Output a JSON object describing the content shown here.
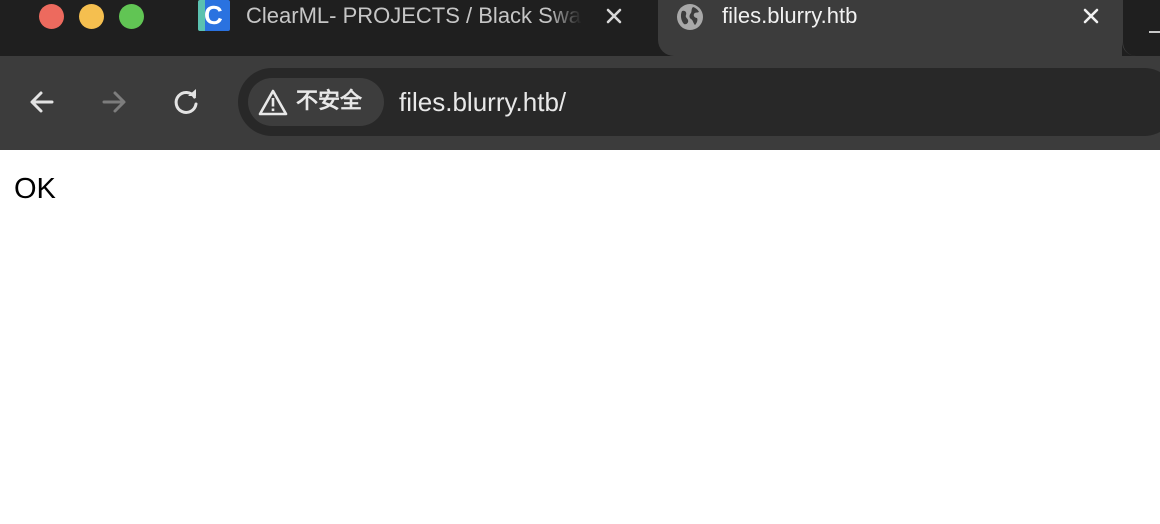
{
  "window_controls": {
    "close_color": "#ed6a5e",
    "minimize_color": "#f5bf4f",
    "maximize_color": "#61c554"
  },
  "tabs": [
    {
      "title": "ClearML- PROJECTS / Black Swan",
      "favicon": "clearml-logo-icon",
      "active": false
    },
    {
      "title": "files.blurry.htb",
      "favicon": "globe-icon",
      "active": true
    }
  ],
  "toolbar": {
    "security_label": "不安全",
    "url": "files.blurry.htb/"
  },
  "page": {
    "body_text": "OK"
  }
}
